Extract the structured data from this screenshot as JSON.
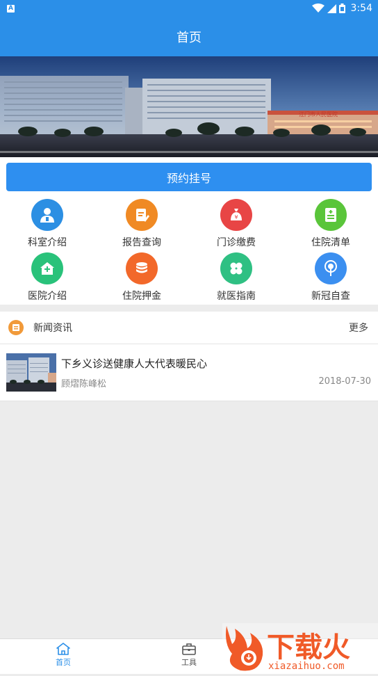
{
  "status_bar": {
    "time": "3:54",
    "notification_icon": "A"
  },
  "app_bar": {
    "title": "首页"
  },
  "banner": {
    "sign_text": "江门市人民医院"
  },
  "booking": {
    "label": "预约挂号"
  },
  "menu": [
    {
      "label": "科室介绍",
      "icon": "doctor-icon",
      "color": "#2c8fe3"
    },
    {
      "label": "报告查询",
      "icon": "report-icon",
      "color": "#f08a24"
    },
    {
      "label": "门诊缴费",
      "icon": "money-bag-icon",
      "color": "#e84545"
    },
    {
      "label": "住院清单",
      "icon": "list-icon",
      "color": "#5ac53a"
    },
    {
      "label": "医院介绍",
      "icon": "hospital-icon",
      "color": "#29c27a"
    },
    {
      "label": "住院押金",
      "icon": "coins-icon",
      "color": "#f2682a"
    },
    {
      "label": "就医指南",
      "icon": "clover-icon",
      "color": "#2fc083"
    },
    {
      "label": "新冠自查",
      "icon": "virus-check-icon",
      "color": "#3b8ff0"
    }
  ],
  "news": {
    "section_title": "新闻资讯",
    "more_label": "更多",
    "items": [
      {
        "title": "下乡义诊送健康人大代表暖民心",
        "author": "顾熠陈峰松",
        "date": "2018-07-30"
      }
    ]
  },
  "tabs": [
    {
      "label": "首页",
      "active": true
    },
    {
      "label": "工具",
      "active": false
    }
  ],
  "watermark": {
    "brand": "下载火",
    "url": "xiazaihuo.com"
  }
}
